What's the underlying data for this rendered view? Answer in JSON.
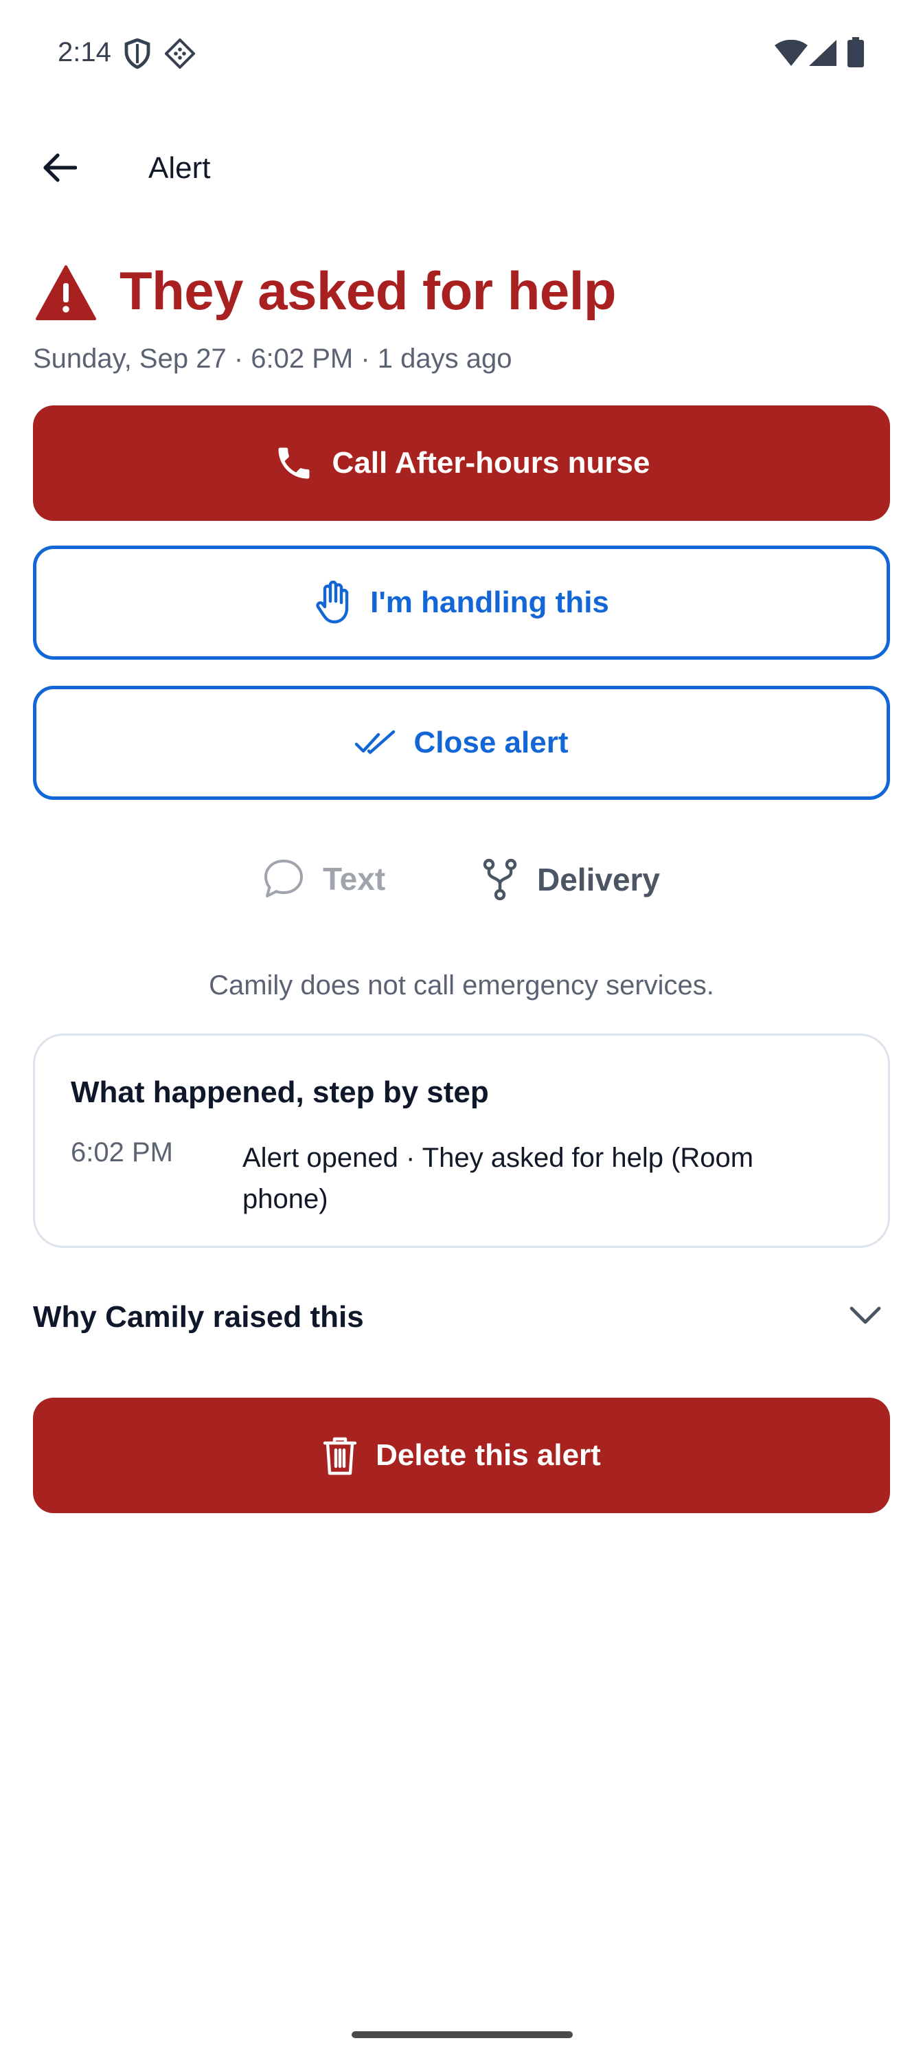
{
  "status_bar": {
    "time": "2:14"
  },
  "app_bar": {
    "title": "Alert"
  },
  "alert": {
    "title": "They asked for help",
    "subtitle": "Sunday, Sep 27 · 6:02 PM · 1 days ago"
  },
  "actions": {
    "call_label": "Call After-hours nurse",
    "handling_label": "I'm handling this",
    "close_label": "Close alert",
    "delete_label": "Delete this alert"
  },
  "channels": {
    "text_label": "Text",
    "delivery_label": "Delivery"
  },
  "notice": "Camily does not call emergency services.",
  "timeline": {
    "title": "What happened, step by step",
    "events": [
      {
        "time": "6:02 PM",
        "description": "Alert opened · They asked for help (Room phone)"
      }
    ]
  },
  "why": {
    "label": "Why Camily raised this"
  },
  "colors": {
    "danger": "#a8221f",
    "primary": "#1366d6",
    "muted_text": "#5b6373"
  },
  "icons": [
    "back-arrow-icon",
    "warning-icon",
    "phone-icon",
    "hand-icon",
    "double-check-icon",
    "chat-bubble-icon",
    "fork-icon",
    "chevron-down-icon",
    "trash-icon"
  ]
}
